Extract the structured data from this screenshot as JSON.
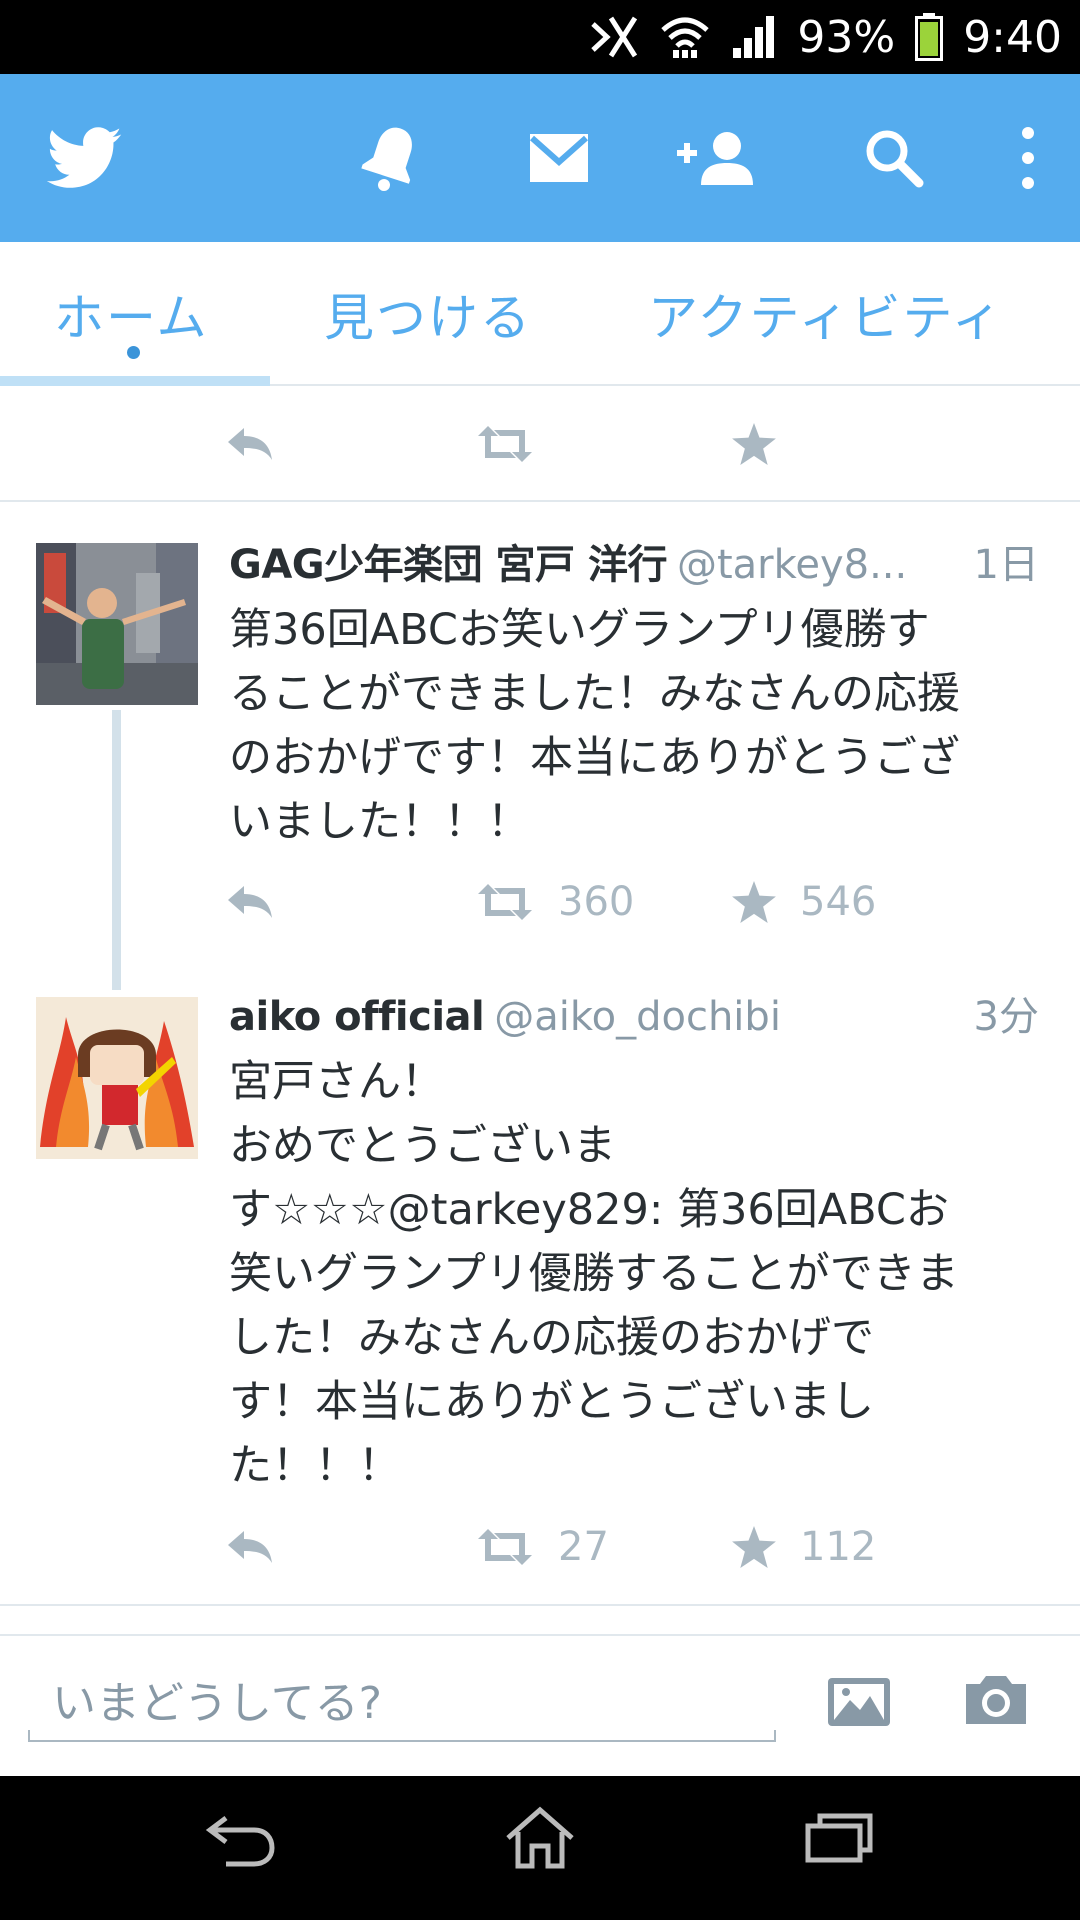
{
  "status_bar": {
    "battery_percent": "93%",
    "time": "9:40",
    "icons": [
      "no-sim-icon",
      "wifi-icon",
      "signal-icon",
      "battery-icon"
    ]
  },
  "app_bar": {
    "background": "#55acee",
    "icons": [
      "twitter-logo-icon",
      "notifications-bell-icon",
      "messages-envelope-icon",
      "follow-person-icon",
      "search-icon",
      "overflow-menu-icon"
    ]
  },
  "tabs": {
    "items": [
      {
        "label": "ホーム",
        "active": true
      },
      {
        "label": "見つける",
        "active": false
      },
      {
        "label": "アクティビティ",
        "active": false
      }
    ],
    "accent": "#55acee"
  },
  "tweets": [
    {
      "name": "GAG少年楽団 宮戸 洋行",
      "handle": "@tarkey8...",
      "time": "1日",
      "text": "第36回ABCお笑いグランプリ優勝す\nることができました！みなさんの応援\nのおかげです！本当にありがとうござ\nいました！！！",
      "retweets": "360",
      "favorites": "546"
    },
    {
      "name": "aiko official",
      "handle": "@aiko_dochibi",
      "time": "3分",
      "text": "宮戸さん！\nおめでとうございま\nす☆☆☆@tarkey829: 第36回ABCお\n笑いグランプリ優勝することができま\nした！みなさんの応援のおかげで\nす！本当にありがとうございまし\nた！！！",
      "retweets": "27",
      "favorites": "112"
    }
  ],
  "compose": {
    "placeholder": "いまどうしてる?",
    "icons": [
      "add-photo-icon",
      "camera-icon"
    ]
  },
  "nav_bar": {
    "icons": [
      "back-icon",
      "home-icon",
      "recent-apps-icon"
    ]
  }
}
